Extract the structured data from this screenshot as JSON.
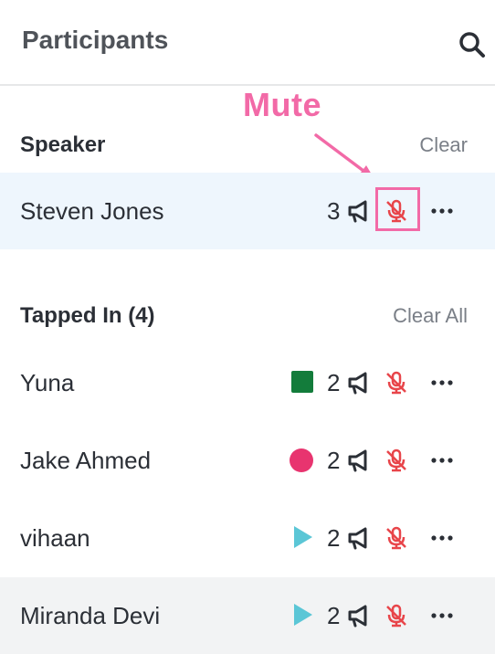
{
  "header": {
    "title": "Participants",
    "search_icon": "search-icon"
  },
  "annotation": {
    "text": "Mute",
    "color": "#f26aa7"
  },
  "speaker_section": {
    "title": "Speaker",
    "clear_label": "Clear",
    "row": {
      "name": "Steven Jones",
      "count": "3"
    }
  },
  "tapped_section": {
    "title": "Tapped In (4)",
    "clear_label": "Clear All",
    "rows": [
      {
        "name": "Yuna",
        "count": "2",
        "status": "green-square",
        "status_color": "#137c3b"
      },
      {
        "name": "Jake Ahmed",
        "count": "2",
        "status": "pink-circle",
        "status_color": "#e8346f"
      },
      {
        "name": "vihaan",
        "count": "2",
        "status": "teal-triangle",
        "status_color": "#5bc6d6"
      },
      {
        "name": "Miranda Devi",
        "count": "2",
        "status": "teal-triangle",
        "status_color": "#5bc6d6"
      }
    ]
  },
  "colors": {
    "mic_muted": "#e8454a",
    "highlight_row": "#eef6fd",
    "hover_row": "#f2f3f4"
  }
}
